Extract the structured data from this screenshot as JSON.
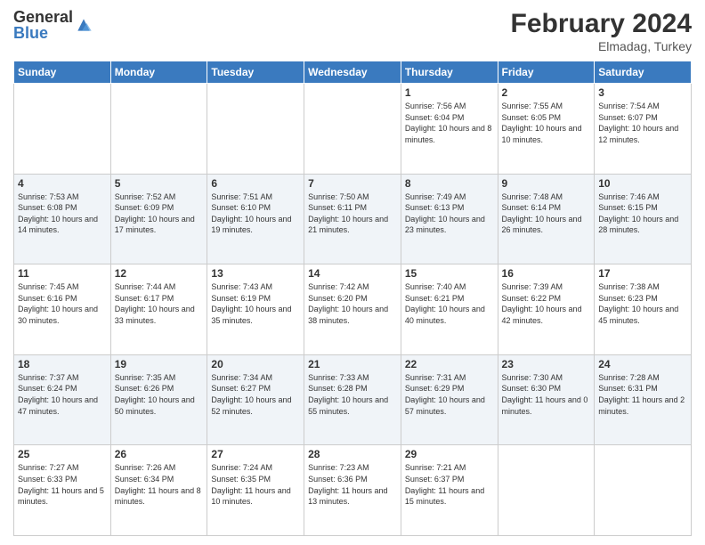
{
  "header": {
    "logo_general": "General",
    "logo_blue": "Blue",
    "month_title": "February 2024",
    "location": "Elmadag, Turkey"
  },
  "days_of_week": [
    "Sunday",
    "Monday",
    "Tuesday",
    "Wednesday",
    "Thursday",
    "Friday",
    "Saturday"
  ],
  "weeks": [
    [
      {
        "day": "",
        "info": ""
      },
      {
        "day": "",
        "info": ""
      },
      {
        "day": "",
        "info": ""
      },
      {
        "day": "",
        "info": ""
      },
      {
        "day": "1",
        "info": "Sunrise: 7:56 AM\nSunset: 6:04 PM\nDaylight: 10 hours and 8 minutes."
      },
      {
        "day": "2",
        "info": "Sunrise: 7:55 AM\nSunset: 6:05 PM\nDaylight: 10 hours and 10 minutes."
      },
      {
        "day": "3",
        "info": "Sunrise: 7:54 AM\nSunset: 6:07 PM\nDaylight: 10 hours and 12 minutes."
      }
    ],
    [
      {
        "day": "4",
        "info": "Sunrise: 7:53 AM\nSunset: 6:08 PM\nDaylight: 10 hours and 14 minutes."
      },
      {
        "day": "5",
        "info": "Sunrise: 7:52 AM\nSunset: 6:09 PM\nDaylight: 10 hours and 17 minutes."
      },
      {
        "day": "6",
        "info": "Sunrise: 7:51 AM\nSunset: 6:10 PM\nDaylight: 10 hours and 19 minutes."
      },
      {
        "day": "7",
        "info": "Sunrise: 7:50 AM\nSunset: 6:11 PM\nDaylight: 10 hours and 21 minutes."
      },
      {
        "day": "8",
        "info": "Sunrise: 7:49 AM\nSunset: 6:13 PM\nDaylight: 10 hours and 23 minutes."
      },
      {
        "day": "9",
        "info": "Sunrise: 7:48 AM\nSunset: 6:14 PM\nDaylight: 10 hours and 26 minutes."
      },
      {
        "day": "10",
        "info": "Sunrise: 7:46 AM\nSunset: 6:15 PM\nDaylight: 10 hours and 28 minutes."
      }
    ],
    [
      {
        "day": "11",
        "info": "Sunrise: 7:45 AM\nSunset: 6:16 PM\nDaylight: 10 hours and 30 minutes."
      },
      {
        "day": "12",
        "info": "Sunrise: 7:44 AM\nSunset: 6:17 PM\nDaylight: 10 hours and 33 minutes."
      },
      {
        "day": "13",
        "info": "Sunrise: 7:43 AM\nSunset: 6:19 PM\nDaylight: 10 hours and 35 minutes."
      },
      {
        "day": "14",
        "info": "Sunrise: 7:42 AM\nSunset: 6:20 PM\nDaylight: 10 hours and 38 minutes."
      },
      {
        "day": "15",
        "info": "Sunrise: 7:40 AM\nSunset: 6:21 PM\nDaylight: 10 hours and 40 minutes."
      },
      {
        "day": "16",
        "info": "Sunrise: 7:39 AM\nSunset: 6:22 PM\nDaylight: 10 hours and 42 minutes."
      },
      {
        "day": "17",
        "info": "Sunrise: 7:38 AM\nSunset: 6:23 PM\nDaylight: 10 hours and 45 minutes."
      }
    ],
    [
      {
        "day": "18",
        "info": "Sunrise: 7:37 AM\nSunset: 6:24 PM\nDaylight: 10 hours and 47 minutes."
      },
      {
        "day": "19",
        "info": "Sunrise: 7:35 AM\nSunset: 6:26 PM\nDaylight: 10 hours and 50 minutes."
      },
      {
        "day": "20",
        "info": "Sunrise: 7:34 AM\nSunset: 6:27 PM\nDaylight: 10 hours and 52 minutes."
      },
      {
        "day": "21",
        "info": "Sunrise: 7:33 AM\nSunset: 6:28 PM\nDaylight: 10 hours and 55 minutes."
      },
      {
        "day": "22",
        "info": "Sunrise: 7:31 AM\nSunset: 6:29 PM\nDaylight: 10 hours and 57 minutes."
      },
      {
        "day": "23",
        "info": "Sunrise: 7:30 AM\nSunset: 6:30 PM\nDaylight: 11 hours and 0 minutes."
      },
      {
        "day": "24",
        "info": "Sunrise: 7:28 AM\nSunset: 6:31 PM\nDaylight: 11 hours and 2 minutes."
      }
    ],
    [
      {
        "day": "25",
        "info": "Sunrise: 7:27 AM\nSunset: 6:33 PM\nDaylight: 11 hours and 5 minutes."
      },
      {
        "day": "26",
        "info": "Sunrise: 7:26 AM\nSunset: 6:34 PM\nDaylight: 11 hours and 8 minutes."
      },
      {
        "day": "27",
        "info": "Sunrise: 7:24 AM\nSunset: 6:35 PM\nDaylight: 11 hours and 10 minutes."
      },
      {
        "day": "28",
        "info": "Sunrise: 7:23 AM\nSunset: 6:36 PM\nDaylight: 11 hours and 13 minutes."
      },
      {
        "day": "29",
        "info": "Sunrise: 7:21 AM\nSunset: 6:37 PM\nDaylight: 11 hours and 15 minutes."
      },
      {
        "day": "",
        "info": ""
      },
      {
        "day": "",
        "info": ""
      }
    ]
  ]
}
